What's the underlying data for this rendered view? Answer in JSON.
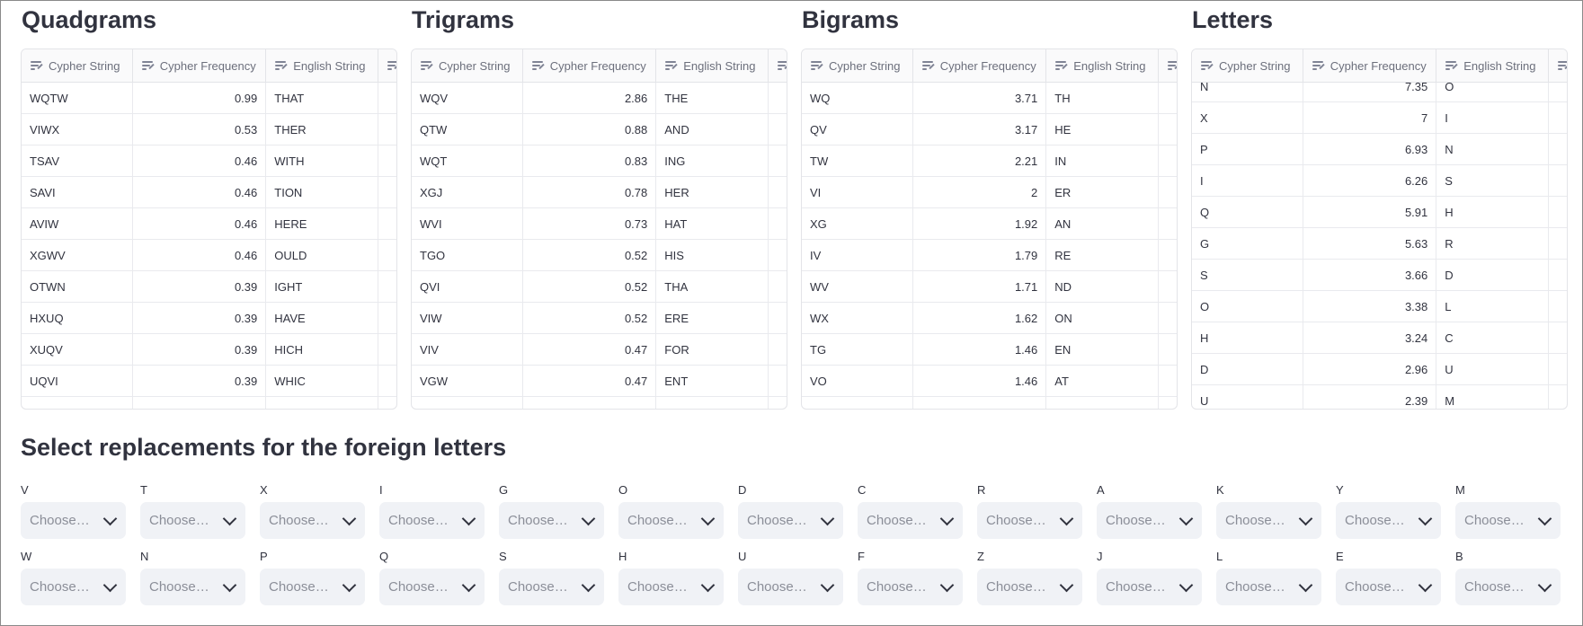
{
  "tables": [
    {
      "title": "Quadgrams",
      "columns": [
        "Cypher String",
        "Cypher Frequency",
        "English String"
      ],
      "rows": [
        [
          "WQTW",
          "0.99",
          "THAT"
        ],
        [
          "VIWX",
          "0.53",
          "THER"
        ],
        [
          "TSAV",
          "0.46",
          "WITH"
        ],
        [
          "SAVI",
          "0.46",
          "TION"
        ],
        [
          "AVIW",
          "0.46",
          "HERE"
        ],
        [
          "XGWV",
          "0.46",
          "OULD"
        ],
        [
          "OTWN",
          "0.39",
          "IGHT"
        ],
        [
          "HXUQ",
          "0.39",
          "HAVE"
        ],
        [
          "XUQV",
          "0.39",
          "HICH"
        ],
        [
          "UQVI",
          "0.39",
          "WHIC"
        ]
      ]
    },
    {
      "title": "Trigrams",
      "columns": [
        "Cypher String",
        "Cypher Frequency",
        "English String"
      ],
      "rows": [
        [
          "WQV",
          "2.86",
          "THE"
        ],
        [
          "QTW",
          "0.88",
          "AND"
        ],
        [
          "WQT",
          "0.83",
          "ING"
        ],
        [
          "XGJ",
          "0.78",
          "HER"
        ],
        [
          "WVI",
          "0.73",
          "HAT"
        ],
        [
          "TGO",
          "0.52",
          "HIS"
        ],
        [
          "QVI",
          "0.52",
          "THA"
        ],
        [
          "VIW",
          "0.52",
          "ERE"
        ],
        [
          "VIV",
          "0.47",
          "FOR"
        ],
        [
          "VGW",
          "0.47",
          "ENT"
        ]
      ]
    },
    {
      "title": "Bigrams",
      "columns": [
        "Cypher String",
        "Cypher Frequency",
        "English String"
      ],
      "rows": [
        [
          "WQ",
          "3.71",
          "TH"
        ],
        [
          "QV",
          "3.17",
          "HE"
        ],
        [
          "TW",
          "2.21",
          "IN"
        ],
        [
          "VI",
          "2",
          "ER"
        ],
        [
          "XG",
          "1.92",
          "AN"
        ],
        [
          "IV",
          "1.79",
          "RE"
        ],
        [
          "WV",
          "1.71",
          "ND"
        ],
        [
          "WX",
          "1.62",
          "ON"
        ],
        [
          "TG",
          "1.46",
          "EN"
        ],
        [
          "VO",
          "1.46",
          "AT"
        ]
      ]
    },
    {
      "title": "Letters",
      "columns": [
        "Cypher String",
        "Cypher Frequency",
        "English String"
      ],
      "scroll_offset_rows": 1,
      "rows": [
        [
          "N",
          "7.35",
          "O"
        ],
        [
          "X",
          "7",
          "I"
        ],
        [
          "P",
          "6.93",
          "N"
        ],
        [
          "I",
          "6.26",
          "S"
        ],
        [
          "Q",
          "5.91",
          "H"
        ],
        [
          "G",
          "5.63",
          "R"
        ],
        [
          "S",
          "3.66",
          "D"
        ],
        [
          "O",
          "3.38",
          "L"
        ],
        [
          "H",
          "3.24",
          "C"
        ],
        [
          "D",
          "2.96",
          "U"
        ],
        [
          "U",
          "2.39",
          "M"
        ]
      ]
    }
  ],
  "replacements": {
    "title": "Select replacements for the foreign letters",
    "placeholder": "Choose…",
    "rows": [
      [
        "V",
        "T",
        "X",
        "I",
        "G",
        "O",
        "D",
        "C",
        "R",
        "A",
        "K",
        "Y",
        "M"
      ],
      [
        "W",
        "N",
        "P",
        "Q",
        "S",
        "H",
        "U",
        "F",
        "Z",
        "J",
        "L",
        "E",
        "B"
      ]
    ]
  }
}
